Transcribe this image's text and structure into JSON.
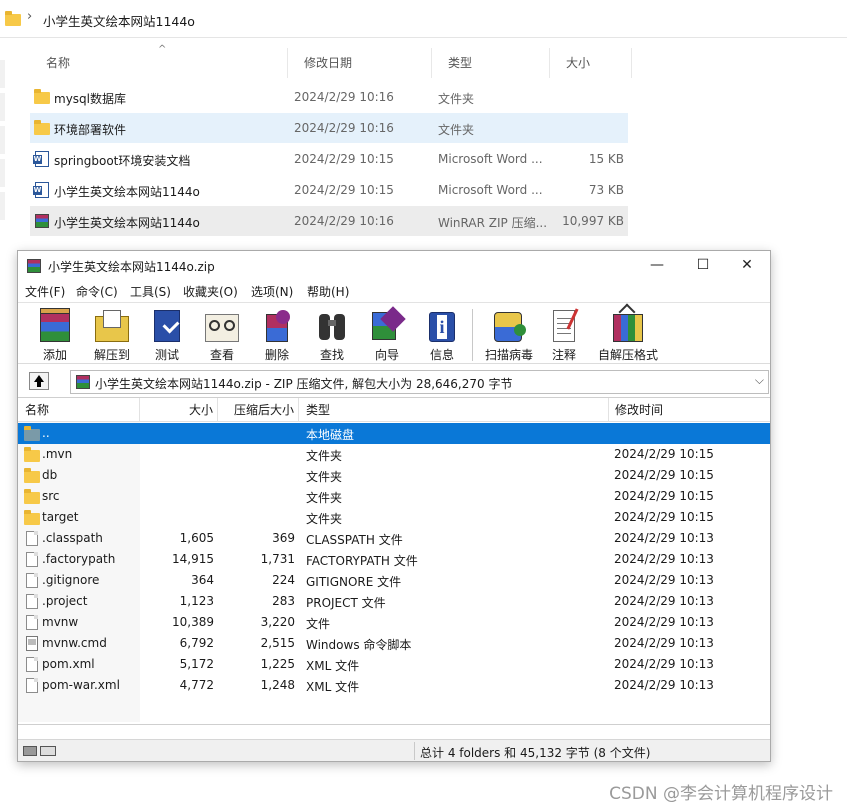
{
  "explorer": {
    "breadcrumb": "小学生英文绘本网站1144o",
    "columns": {
      "name": "名称",
      "date": "修改日期",
      "type": "类型",
      "size": "大小"
    },
    "rows": [
      {
        "name": "mysql数据库",
        "date": "2024/2/29 10:16",
        "type": "文件夹",
        "size": "",
        "icon": "folder-icon"
      },
      {
        "name": "环境部署软件",
        "date": "2024/2/29 10:16",
        "type": "文件夹",
        "size": "",
        "icon": "folder-icon"
      },
      {
        "name": "springboot环境安装文档",
        "date": "2024/2/29 10:15",
        "type": "Microsoft Word ...",
        "size": "15 KB",
        "icon": "word-doc-icon"
      },
      {
        "name": "小学生英文绘本网站1144o",
        "date": "2024/2/29 10:15",
        "type": "Microsoft Word ...",
        "size": "73 KB",
        "icon": "word-doc-icon"
      },
      {
        "name": "小学生英文绘本网站1144o",
        "date": "2024/2/29 10:16",
        "type": "WinRAR ZIP 压缩...",
        "size": "10,997 KB",
        "icon": "winrar-archive-icon"
      }
    ]
  },
  "winrar": {
    "title": "小学生英文绘本网站1144o.zip",
    "window_buttons": {
      "minimize": "—",
      "maximize": "☐",
      "close": "✕"
    },
    "menu": [
      "文件(F)",
      "命令(C)",
      "工具(S)",
      "收藏夹(O)",
      "选项(N)",
      "帮助(H)"
    ],
    "toolbar": [
      "添加",
      "解压到",
      "测试",
      "查看",
      "删除",
      "查找",
      "向导",
      "信息",
      "扫描病毒",
      "注释",
      "自解压格式"
    ],
    "address": "小学生英文绘本网站1144o.zip - ZIP 压缩文件, 解包大小为 28,646,270 字节",
    "columns": {
      "name": "名称",
      "size": "大小",
      "packed": "压缩后大小",
      "type": "类型",
      "modified": "修改时间"
    },
    "files": [
      {
        "name": "..",
        "size": "",
        "packed": "",
        "type": "本地磁盘",
        "modified": "",
        "icon": "parent-folder-icon"
      },
      {
        "name": ".mvn",
        "size": "",
        "packed": "",
        "type": "文件夹",
        "modified": "2024/2/29 10:15",
        "icon": "folder-icon"
      },
      {
        "name": "db",
        "size": "",
        "packed": "",
        "type": "文件夹",
        "modified": "2024/2/29 10:15",
        "icon": "folder-icon"
      },
      {
        "name": "src",
        "size": "",
        "packed": "",
        "type": "文件夹",
        "modified": "2024/2/29 10:15",
        "icon": "folder-icon"
      },
      {
        "name": "target",
        "size": "",
        "packed": "",
        "type": "文件夹",
        "modified": "2024/2/29 10:15",
        "icon": "folder-icon"
      },
      {
        "name": ".classpath",
        "size": "1,605",
        "packed": "369",
        "type": "CLASSPATH 文件",
        "modified": "2024/2/29 10:13",
        "icon": "file-icon"
      },
      {
        "name": ".factorypath",
        "size": "14,915",
        "packed": "1,731",
        "type": "FACTORYPATH 文件",
        "modified": "2024/2/29 10:13",
        "icon": "file-icon"
      },
      {
        "name": ".gitignore",
        "size": "364",
        "packed": "224",
        "type": "GITIGNORE 文件",
        "modified": "2024/2/29 10:13",
        "icon": "file-icon"
      },
      {
        "name": ".project",
        "size": "1,123",
        "packed": "283",
        "type": "PROJECT 文件",
        "modified": "2024/2/29 10:13",
        "icon": "file-icon"
      },
      {
        "name": "mvnw",
        "size": "10,389",
        "packed": "3,220",
        "type": "文件",
        "modified": "2024/2/29 10:13",
        "icon": "file-icon"
      },
      {
        "name": "mvnw.cmd",
        "size": "6,792",
        "packed": "2,515",
        "type": "Windows 命令脚本",
        "modified": "2024/2/29 10:13",
        "icon": "cmd-script-icon"
      },
      {
        "name": "pom.xml",
        "size": "5,172",
        "packed": "1,225",
        "type": "XML 文件",
        "modified": "2024/2/29 10:13",
        "icon": "file-icon"
      },
      {
        "name": "pom-war.xml",
        "size": "4,772",
        "packed": "1,248",
        "type": "XML 文件",
        "modified": "2024/2/29 10:13",
        "icon": "file-icon"
      }
    ],
    "status": "总计 4 folders 和 45,132 字节 (8 个文件)"
  },
  "watermark": "CSDN @李会计算机程序设计"
}
